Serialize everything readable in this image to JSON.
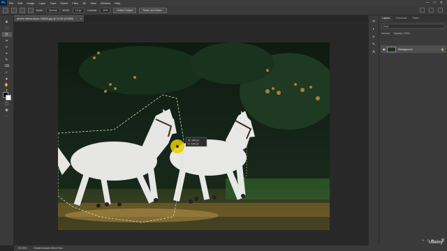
{
  "app": {
    "logo": "Ps"
  },
  "menu": [
    "File",
    "Edit",
    "Image",
    "Layer",
    "Type",
    "Select",
    "Filter",
    "3D",
    "View",
    "Window",
    "Help"
  ],
  "window_controls": [
    "—",
    "□",
    "✕"
  ],
  "options": {
    "mode_label": "Mode:",
    "mode_value": "Normal",
    "width_label": "Width:",
    "width_value": "10 px",
    "contrast_label": "Contrast:",
    "contrast_value": "10%",
    "select_subject": "Select Subject",
    "select_and_mask": "Select and Mask..."
  },
  "document": {
    "tab_title": "pexels-helena-lopes-796653.jpg @ 33.3% (RGB/8)",
    "close": "×"
  },
  "toolbar": {
    "tools": [
      "✥",
      "⬚",
      "ʘ",
      "⌗",
      "✂",
      "⌖",
      "✎",
      "⌫",
      "◐",
      "▲",
      "✋",
      "T",
      "⬡",
      "◯",
      "◉",
      "⋯"
    ]
  },
  "cursor_tip": {
    "line1": "W: 246 px",
    "line2": "H: 164 px"
  },
  "layers_panel": {
    "tabs": [
      "Layers",
      "Channels",
      "Paths"
    ],
    "filter": "Kind",
    "blend_mode": "Normal",
    "opacity": "Opacity: 100%",
    "layer_name": "Background"
  },
  "status": {
    "zoom": "33.33%",
    "info": "Content-Aware Move Tool"
  },
  "watermark": "Udemy",
  "colors": {
    "accent": "#31a8ff",
    "selection": "#cfe0a8",
    "cursor": "#e8d000"
  }
}
